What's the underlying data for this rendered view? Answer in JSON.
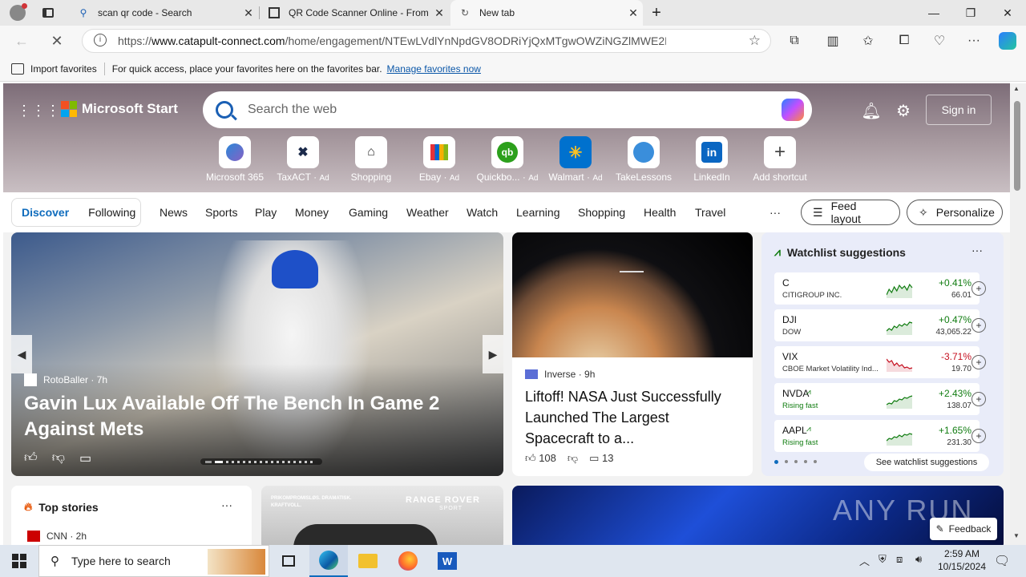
{
  "tabs": [
    {
      "title": "scan qr code - Search"
    },
    {
      "title": "QR Code Scanner Online - From"
    },
    {
      "title": "New tab"
    }
  ],
  "address": {
    "prefix": "https://",
    "host": "www.catapult-connect.com",
    "path": "/home/engagement/NTEwLVdlYnNpdGV8ODRiYjQxMTgwOWZiNGZlMWE2N2E2NjFhZDhl..."
  },
  "favbar": {
    "import": "Import favorites",
    "hint": "For quick access, place your favorites here on the favorites bar.",
    "manage": "Manage favorites now"
  },
  "start": {
    "brand": "Microsoft Start",
    "search_placeholder": "Search the web",
    "signin": "Sign in",
    "shortcuts": [
      {
        "label": "Microsoft 365",
        "ad": ""
      },
      {
        "label": "TaxACT",
        "ad": "Ad"
      },
      {
        "label": "Shopping",
        "ad": ""
      },
      {
        "label": "Ebay",
        "ad": "Ad"
      },
      {
        "label": "Quickbo...",
        "ad": "Ad"
      },
      {
        "label": "Walmart",
        "ad": "Ad"
      },
      {
        "label": "TakeLessons",
        "ad": ""
      },
      {
        "label": "LinkedIn",
        "ad": ""
      },
      {
        "label": "Add shortcut",
        "ad": ""
      }
    ],
    "pill": [
      "Discover",
      "Following"
    ],
    "nav": [
      "News",
      "Sports",
      "Play",
      "Money",
      "Gaming",
      "Weather",
      "Watch",
      "Learning",
      "Shopping",
      "Health",
      "Travel"
    ],
    "more": "···",
    "feed_layout": "Feed layout",
    "personalize": "Personalize"
  },
  "hero_story": {
    "source": "RotoBaller",
    "age": "7h",
    "headline": "Gavin Lux Available Off The Bench In Game 2 Against Mets"
  },
  "nasa_story": {
    "source": "Inverse",
    "age": "9h",
    "headline": "Liftoff! NASA Just Successfully Launched The Largest Spacecraft to a...",
    "likes": "108",
    "comments": "13"
  },
  "watchlist": {
    "title": "Watchlist suggestions",
    "footer": "See watchlist suggestions",
    "stocks": [
      {
        "sym": "C",
        "name": "CITIGROUP INC.",
        "change": "+0.41%",
        "price": "66.01",
        "up": true,
        "extra": ""
      },
      {
        "sym": "DJI",
        "name": "DOW",
        "change": "+0.47%",
        "price": "43,065.22",
        "up": true,
        "extra": ""
      },
      {
        "sym": "VIX",
        "name": "CBOE Market Volatility Ind...",
        "change": "-3.71%",
        "price": "19.70",
        "up": false,
        "extra": ""
      },
      {
        "sym": "NVDA",
        "name": "Rising fast",
        "change": "+2.43%",
        "price": "138.07",
        "up": true,
        "extra": "rising"
      },
      {
        "sym": "AAPL",
        "name": "Rising fast",
        "change": "+1.65%",
        "price": "231.30",
        "up": true,
        "extra": "rising"
      }
    ]
  },
  "top_stories": {
    "title": "Top stories",
    "source": "CNN",
    "age": "2h"
  },
  "range_rover": {
    "tagline": "PRIKOMPROMISLØS. DRAMATISK. KRAFTVOLL.",
    "brand": "RANGE ROVER",
    "sub": "SPORT"
  },
  "feedback": "Feedback",
  "watermark": "ANY RUN",
  "taskbar": {
    "search": "Type here to search",
    "time": "2:59 AM",
    "date": "10/15/2024"
  },
  "colors": {
    "accent": "#0f6cbd",
    "up": "#107c10",
    "down": "#c50f1f"
  }
}
